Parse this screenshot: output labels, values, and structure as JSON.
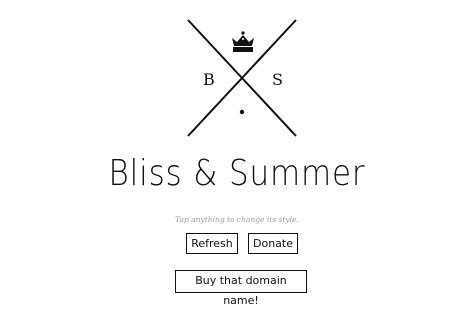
{
  "logo": {
    "left_letter": "B",
    "right_letter": "S",
    "crown_icon": "crown-icon",
    "dot_icon": "dot-icon"
  },
  "title": "Bliss & Summer",
  "hint": "Tap anything to change its style.",
  "buttons": {
    "refresh": "Refresh",
    "donate": "Donate",
    "domain": "Buy that domain name!"
  },
  "colors": {
    "ink": "#111111",
    "hint": "#9a9a9a",
    "background": "#ffffff"
  }
}
